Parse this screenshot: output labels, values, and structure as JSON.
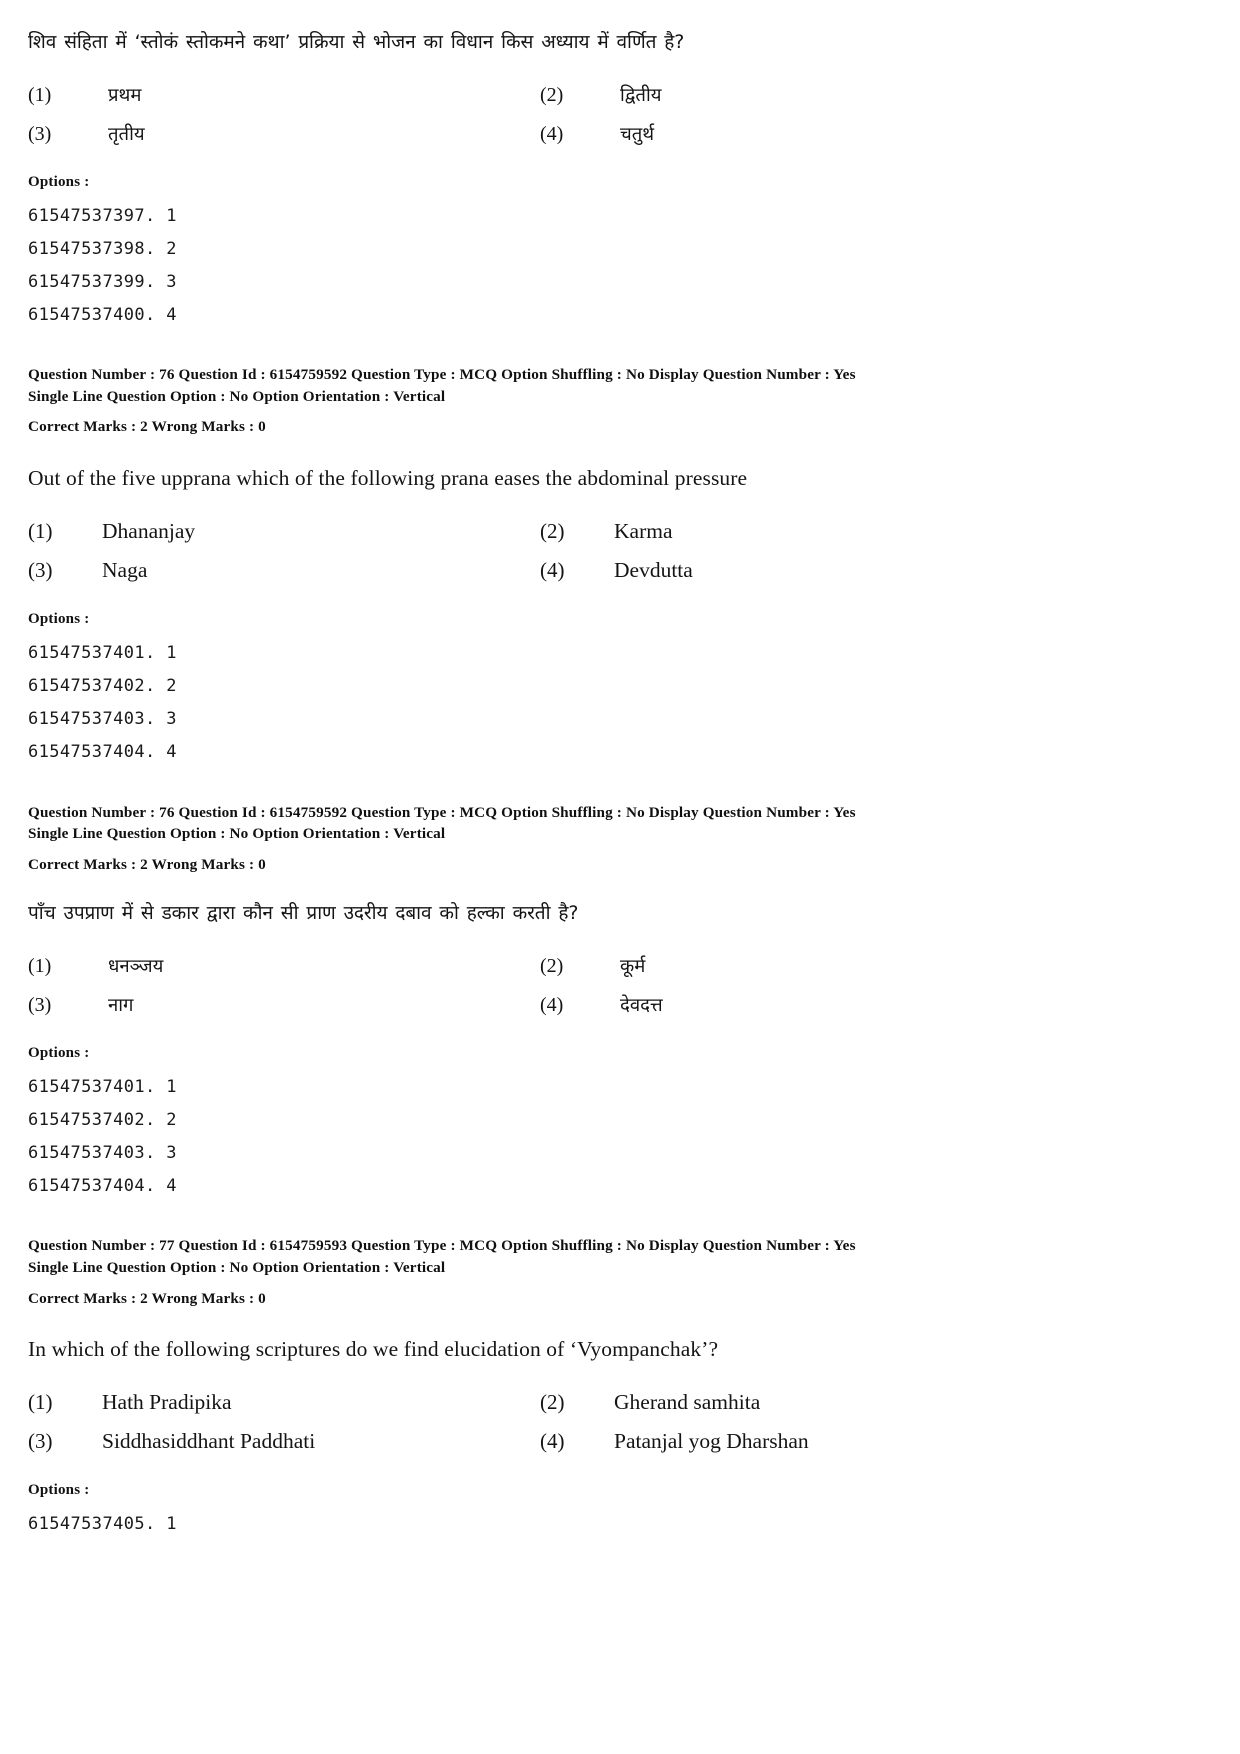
{
  "page": {
    "document_type": "exam-question-paper"
  },
  "blocks": [
    {
      "id": "q76-hindi-stem",
      "kind": "question",
      "lang": "hindi",
      "stem": "शिव संहिता में ‘स्तोकं स्तोकमने कथा’ प्रक्रिया से भोजन का विधान किस अध्याय में वर्णित है?",
      "choices": [
        {
          "num": "(1)",
          "text": "प्रथम"
        },
        {
          "num": "(2)",
          "text": "द्वितीय"
        },
        {
          "num": "(3)",
          "text": "तृतीय"
        },
        {
          "num": "(4)",
          "text": "चतुर्थ"
        }
      ],
      "options_title": "Options :",
      "option_ids": [
        "61547537397. 1",
        "61547537398. 2",
        "61547537399. 3",
        "61547537400. 4"
      ]
    },
    {
      "id": "meta-76-a",
      "kind": "meta",
      "row1": "Question Number : 76  Question Id : 6154759592  Question Type : MCQ  Option Shuffling : No  Display Question Number : Yes",
      "row2": "Single Line Question Option : No  Option Orientation : Vertical",
      "row3": "Correct Marks : 2 Wrong Marks : 0"
    },
    {
      "id": "q76-english-stem",
      "kind": "question",
      "lang": "english",
      "stem": "Out of the five upprana which of the following prana eases the abdominal pressure",
      "choices": [
        {
          "num": "(1)",
          "text": "Dhananjay"
        },
        {
          "num": "(2)",
          "text": "Karma"
        },
        {
          "num": "(3)",
          "text": "Naga"
        },
        {
          "num": "(4)",
          "text": "Devdutta"
        }
      ],
      "options_title": "Options :",
      "option_ids": [
        "61547537401. 1",
        "61547537402. 2",
        "61547537403. 3",
        "61547537404. 4"
      ]
    },
    {
      "id": "meta-76-b",
      "kind": "meta",
      "row1": "Question Number : 76  Question Id : 6154759592  Question Type : MCQ  Option Shuffling : No  Display Question Number : Yes",
      "row2": "Single Line Question Option : No  Option Orientation : Vertical",
      "row3": "Correct Marks : 2 Wrong Marks : 0"
    },
    {
      "id": "q76-hindi-stem-2",
      "kind": "question",
      "lang": "hindi",
      "stem": "पाँच उपप्राण में से डकार द्वारा कौन सी प्राण उदरीय दबाव को हल्का करती है?",
      "choices": [
        {
          "num": "(1)",
          "text": "धनञ्जय"
        },
        {
          "num": "(2)",
          "text": "कूर्म"
        },
        {
          "num": "(3)",
          "text": "नाग"
        },
        {
          "num": "(4)",
          "text": "देवदत्त"
        }
      ],
      "options_title": "Options :",
      "option_ids": [
        "61547537401. 1",
        "61547537402. 2",
        "61547537403. 3",
        "61547537404. 4"
      ]
    },
    {
      "id": "meta-77",
      "kind": "meta",
      "row1": "Question Number : 77  Question Id : 6154759593  Question Type : MCQ  Option Shuffling : No  Display Question Number : Yes",
      "row2": "Single Line Question Option : No  Option Orientation : Vertical",
      "row3": "Correct Marks : 2 Wrong Marks : 0"
    },
    {
      "id": "q77-english-stem",
      "kind": "question",
      "lang": "english",
      "stem": "In which of the following scriptures do we find elucidation of ‘Vyompanchak’?",
      "choices": [
        {
          "num": "(1)",
          "text": "Hath Pradipika"
        },
        {
          "num": "(2)",
          "text": "Gherand samhita"
        },
        {
          "num": "(3)",
          "text": "Siddhasiddhant Paddhati"
        },
        {
          "num": "(4)",
          "text": "Patanjal yog Dharshan"
        }
      ],
      "options_title": "Options :",
      "option_ids": [
        "61547537405. 1"
      ]
    }
  ]
}
